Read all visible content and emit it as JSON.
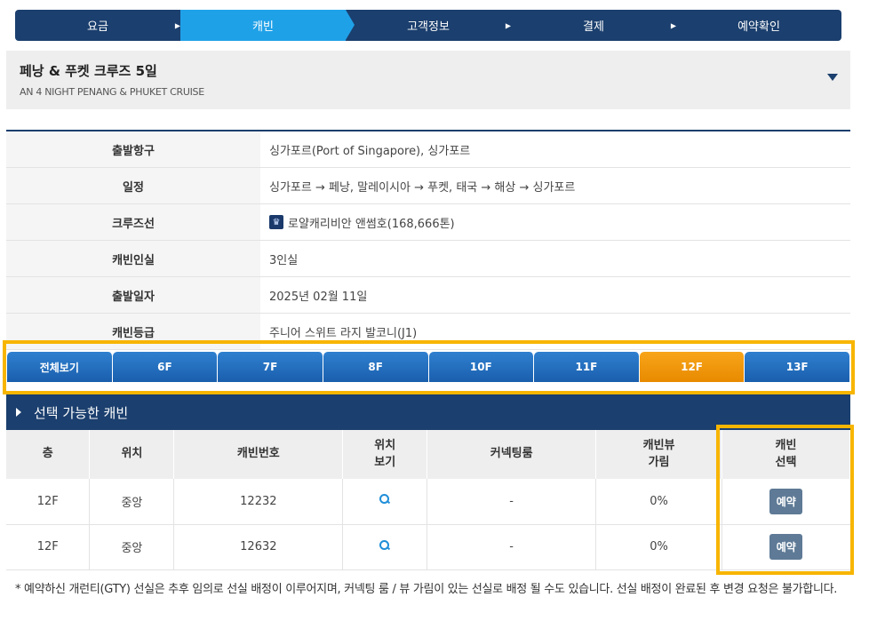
{
  "steps": [
    {
      "label": "요금"
    },
    {
      "label": "캐빈"
    },
    {
      "label": "고객정보"
    },
    {
      "label": "결제"
    },
    {
      "label": "예약확인"
    }
  ],
  "cruise": {
    "title": "페낭 & 푸켓 크루즈 5일",
    "subtitle": "AN 4 NIGHT PENANG & PHUKET CRUISE"
  },
  "info": [
    {
      "label": "출발항구",
      "value": "싱가포르(Port of Singapore), 싱가포르"
    },
    {
      "label": "일정",
      "value": "싱가포르 → 페낭, 말레이시아 → 푸켓, 태국 → 해상 → 싱가포르"
    },
    {
      "label": "크루즈선",
      "value": "로얄캐리비안 앤썸호(168,666톤)"
    },
    {
      "label": "캐빈인실",
      "value": "3인실"
    },
    {
      "label": "출발일자",
      "value": "2025년 02월 11일"
    },
    {
      "label": "캐빈등급",
      "value": "주니어 스위트 라지 발코니(J1)"
    }
  ],
  "deck_tabs": [
    "전체보기",
    "6F",
    "7F",
    "8F",
    "10F",
    "11F",
    "12F",
    "13F"
  ],
  "section_title": "선택 가능한 캐빈",
  "table": {
    "headers": [
      "층",
      "위치",
      "캐빈번호",
      "위치\n보기",
      "커넥팅룸",
      "캐빈뷰\n가림",
      "캐빈\n선택"
    ],
    "rows": [
      {
        "floor": "12F",
        "location": "중앙",
        "cabin": "12232",
        "connecting": "-",
        "view": "0%",
        "button": "예약"
      },
      {
        "floor": "12F",
        "location": "중앙",
        "cabin": "12632",
        "connecting": "-",
        "view": "0%",
        "button": "예약"
      }
    ]
  },
  "notice": "* 예약하신 개런티(GTY) 선실은 추후 임의로 선실 배정이 이루어지며, 커넥팅 룸 / 뷰 가림이 있는 선실로 배정 될 수도 있습니다. 선실 배정이 완료된 후 변경 요청은 불가합니다.",
  "colors": {
    "navy": "#1b3f6e",
    "active_step": "#1fa1e8",
    "active_deck": "#f8a51a",
    "highlight": "#f7b500",
    "button": "#5e7a96"
  }
}
